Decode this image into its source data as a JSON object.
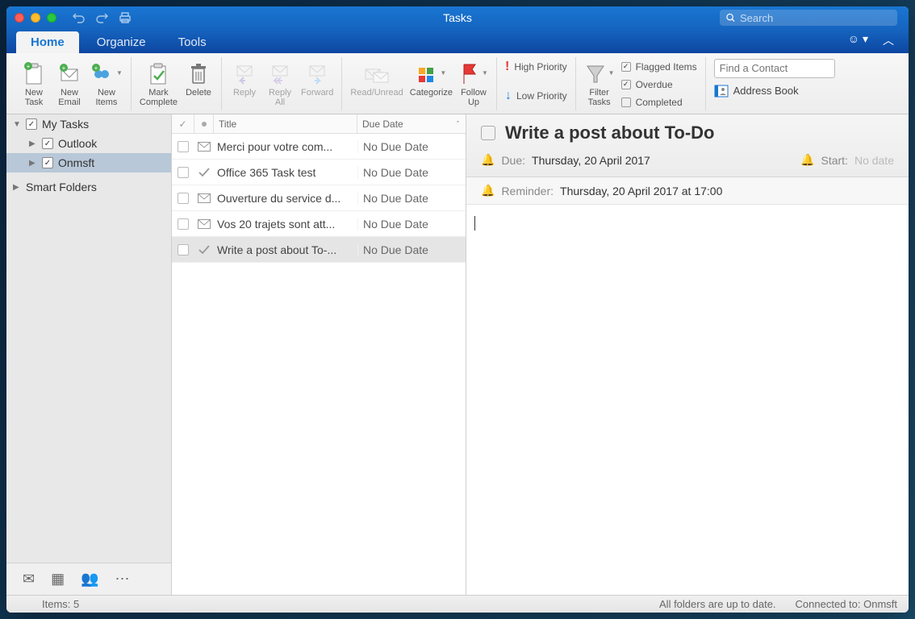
{
  "window": {
    "title": "Tasks"
  },
  "search": {
    "placeholder": "Search"
  },
  "tabs": {
    "home": "Home",
    "organize": "Organize",
    "tools": "Tools"
  },
  "ribbon": {
    "new_task": "New\nTask",
    "new_email": "New\nEmail",
    "new_items": "New\nItems",
    "mark_complete": "Mark\nComplete",
    "delete": "Delete",
    "reply": "Reply",
    "reply_all": "Reply\nAll",
    "forward": "Forward",
    "read_unread": "Read/Unread",
    "categorize": "Categorize",
    "follow_up": "Follow\nUp",
    "high_priority": "High Priority",
    "low_priority": "Low Priority",
    "filter_tasks": "Filter\nTasks",
    "flagged_items": "Flagged Items",
    "overdue": "Overdue",
    "completed": "Completed",
    "find_contact": "Find a Contact",
    "address_book": "Address Book"
  },
  "sidebar": {
    "my_tasks": "My Tasks",
    "outlook": "Outlook",
    "onmsft": "Onmsft",
    "smart_folders": "Smart Folders"
  },
  "list": {
    "col_title": "Title",
    "col_due": "Due Date",
    "rows": [
      {
        "title": "Merci pour votre com...",
        "due": "No Due Date",
        "icon": "mail"
      },
      {
        "title": "Office 365 Task test",
        "due": "No Due Date",
        "icon": "check"
      },
      {
        "title": "Ouverture du service d...",
        "due": "No Due Date",
        "icon": "mail"
      },
      {
        "title": "Vos 20 trajets sont att...",
        "due": "No Due Date",
        "icon": "mail"
      },
      {
        "title": "Write a post about To-...",
        "due": "No Due Date",
        "icon": "check"
      }
    ]
  },
  "detail": {
    "title": "Write a post about To-Do",
    "due_label": "Due:",
    "due_value": "Thursday, 20 April 2017",
    "start_label": "Start:",
    "start_value": "No date",
    "reminder_label": "Reminder:",
    "reminder_value": "Thursday, 20 April 2017 at 17:00"
  },
  "status": {
    "items": "Items: 5",
    "uptodate": "All folders are up to date.",
    "connected": "Connected to: Onmsft"
  }
}
